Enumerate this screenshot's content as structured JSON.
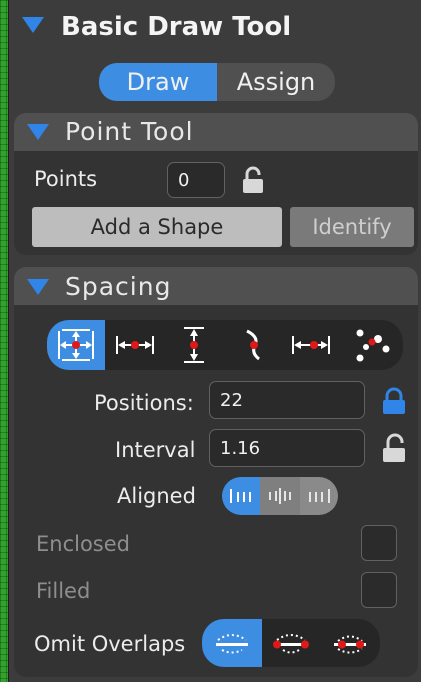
{
  "header": {
    "title": "Basic Draw Tool"
  },
  "mode_toggle": {
    "draw_label": "Draw",
    "assign_label": "Assign",
    "selected": "Draw"
  },
  "point_tool": {
    "title": "Point Tool",
    "points_label": "Points",
    "points_value": "0",
    "add_shape_label": "Add a Shape",
    "identify_label": "Identify"
  },
  "spacing": {
    "title": "Spacing",
    "modes": [
      "distribute-both-icon",
      "width-spacing-icon",
      "height-spacing-icon",
      "curve-spacing-icon",
      "edge-spacing-icon",
      "random-points-icon"
    ],
    "selected_mode": 0,
    "positions_label": "Positions:",
    "positions_value": "22",
    "interval_label": "Interval",
    "interval_value": "1.16",
    "aligned_label": "Aligned",
    "aligned_selected": 0,
    "enclosed_label": "Enclosed",
    "filled_label": "Filled",
    "omit_overlaps_label": "Omit Overlaps",
    "omit_selected": 0
  },
  "colors": {
    "accent": "#3d8ee3",
    "lock_locked": "#2f86e8",
    "lock_unlocked": "#d8d8d8",
    "dot": "#e01818"
  }
}
